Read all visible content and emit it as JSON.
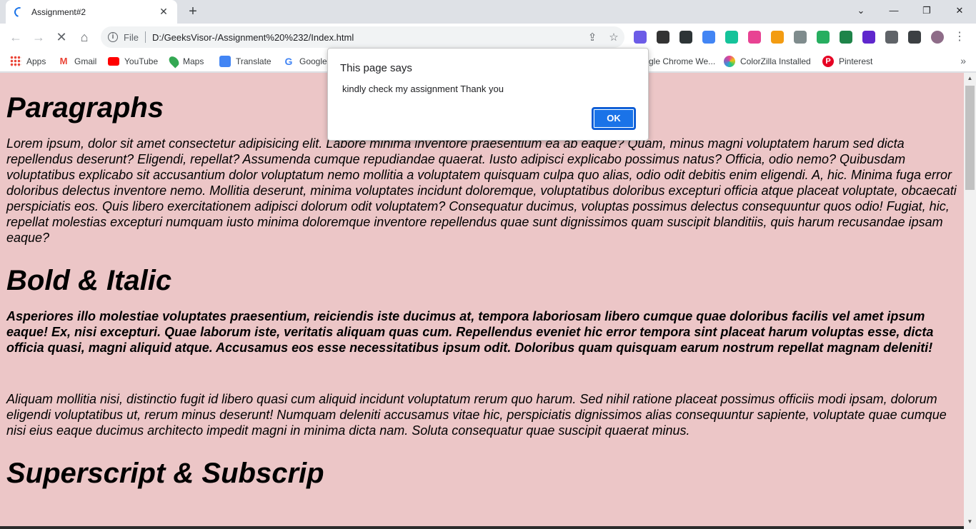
{
  "tab": {
    "title": "Assignment#2",
    "close": "✕"
  },
  "new_tab": "+",
  "window": {
    "minimize": "—",
    "restore": "❐",
    "close": "✕",
    "tablist": "⌄"
  },
  "nav": {
    "back": "←",
    "forward": "→",
    "reload": "✕",
    "home": "⌂"
  },
  "omnibox": {
    "scheme_label": "File",
    "url": "D:/GeeksVisor-/Assignment%20%232/Index.html",
    "share": "⇪",
    "bookmark_star": "☆"
  },
  "extensions": [
    {
      "name": "ext-d",
      "color": "#6c5ce7"
    },
    {
      "name": "ext-m",
      "color": "#333333"
    },
    {
      "name": "ext-eyedropper",
      "color": "#2d3436"
    },
    {
      "name": "ext-translate",
      "color": "#4285f4"
    },
    {
      "name": "ext-grammarly",
      "color": "#15c39a"
    },
    {
      "name": "ext-colorgrid",
      "color": "#e84393"
    },
    {
      "name": "ext-orange",
      "color": "#f39c12"
    },
    {
      "name": "ext-t",
      "color": "#7f8c8d"
    },
    {
      "name": "ext-camera",
      "color": "#27ae60"
    },
    {
      "name": "ext-green",
      "color": "#1e8449"
    },
    {
      "name": "ext-purple",
      "color": "#5f27cd"
    },
    {
      "name": "ext-puzzle",
      "color": "#5f6368"
    },
    {
      "name": "ext-sidepanel",
      "color": "#3c4043"
    },
    {
      "name": "ext-avatar",
      "color": "#8e6c88"
    }
  ],
  "menu": "⋮",
  "bookmarks": [
    {
      "label": "Apps",
      "color": "#ea4335"
    },
    {
      "label": "Gmail",
      "color": "#ea4335"
    },
    {
      "label": "YouTube",
      "color": "#ff0000"
    },
    {
      "label": "Maps",
      "color": "#34a853"
    },
    {
      "label": "Translate",
      "color": "#4285f4"
    },
    {
      "label": "Google",
      "color": "#4285f4"
    },
    {
      "label": "gle Chrome We...",
      "color": ""
    },
    {
      "label": "ColorZilla Installed",
      "color": "#e84393"
    },
    {
      "label": "Pinterest",
      "color": "#e60023"
    }
  ],
  "bookmarks_more": "»",
  "page": {
    "h1": "Paragraphs",
    "p1": "Lorem ipsum, dolor sit amet consectetur adipisicing elit. Labore minima inventore praesentium ea ab eaque? Quam, minus magni voluptatem harum sed dicta repellendus deserunt? Eligendi, repellat? Assumenda cumque repudiandae quaerat. Iusto adipisci explicabo possimus natus? Officia, odio nemo? Quibusdam voluptatibus explicabo sit accusantium dolor voluptatum nemo mollitia a voluptatem quisquam culpa quo alias, odio odit debitis enim eligendi. A, hic. Minima fuga error doloribus delectus inventore nemo. Mollitia deserunt, minima voluptates incidunt doloremque, voluptatibus doloribus excepturi officia atque placeat voluptate, obcaecati perspiciatis eos. Quis libero exercitationem adipisci dolorum odit voluptatem? Consequatur ducimus, voluptas possimus delectus consequuntur quos odio! Fugiat, hic, repellat molestias excepturi numquam iusto minima doloremque inventore repellendus quae sunt dignissimos quam suscipit blanditiis, quis harum recusandae ipsam eaque?",
    "h2": "Bold & Italic",
    "p2": "Asperiores illo molestiae voluptates praesentium, reiciendis iste ducimus at, tempora laboriosam libero cumque quae doloribus facilis vel amet ipsum eaque! Ex, nisi excepturi. Quae laborum iste, veritatis aliquam quas cum. Repellendus eveniet hic error tempora sint placeat harum voluptas esse, dicta officia quasi, magni aliquid atque. Accusamus eos esse necessitatibus ipsum odit. Doloribus quam quisquam earum nostrum repellat magnam deleniti!",
    "p3": "Aliquam mollitia nisi, distinctio fugit id libero quasi cum aliquid incidunt voluptatum rerum quo harum. Sed nihil ratione placeat possimus officiis modi ipsam, dolorum eligendi voluptatibus ut, rerum minus deserunt! Numquam deleniti accusamus vitae hic, perspiciatis dignissimos alias consequuntur sapiente, voluptate quae cumque nisi eius eaque ducimus architecto impedit magni in minima dicta nam. Soluta consequatur quae suscipit quaerat minus.",
    "h3": "Superscript & Subscrip"
  },
  "dialog": {
    "title": "This page says",
    "message": "kindly check my assignment Thank you",
    "ok": "OK"
  }
}
